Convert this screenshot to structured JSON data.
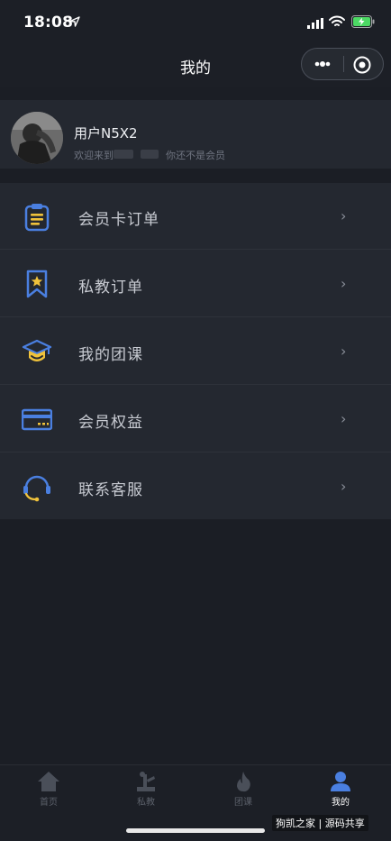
{
  "status_bar": {
    "time": "18:08"
  },
  "nav": {
    "title": "我的"
  },
  "profile": {
    "username": "用户N5X2",
    "subtitle_prefix": "欢迎来到",
    "subtitle_suffix": "你还不是会员"
  },
  "menu": [
    {
      "label": "会员卡订单",
      "icon": "clipboard-icon",
      "arrow": "›"
    },
    {
      "label": "私教订单",
      "icon": "bookmark-star-icon",
      "arrow": "›"
    },
    {
      "label": "我的团课",
      "icon": "graduation-cap-icon",
      "arrow": "›"
    },
    {
      "label": "会员权益",
      "icon": "card-icon",
      "arrow": "›"
    },
    {
      "label": "联系客服",
      "icon": "headset-icon",
      "arrow": "›"
    }
  ],
  "tabs": [
    {
      "label": "首页",
      "icon": "home-icon",
      "active": false
    },
    {
      "label": "私教",
      "icon": "fitness-icon",
      "active": false
    },
    {
      "label": "团课",
      "icon": "flame-icon",
      "active": false
    },
    {
      "label": "我的",
      "icon": "user-icon",
      "active": true
    }
  ],
  "watermark": "狗凯之家 | 源码共享",
  "colors": {
    "background": "#1b1e25",
    "card": "#242830",
    "icon_blue": "#4a7fe0",
    "icon_yellow": "#f0c23b",
    "tab_active": "#4a7fe0"
  }
}
